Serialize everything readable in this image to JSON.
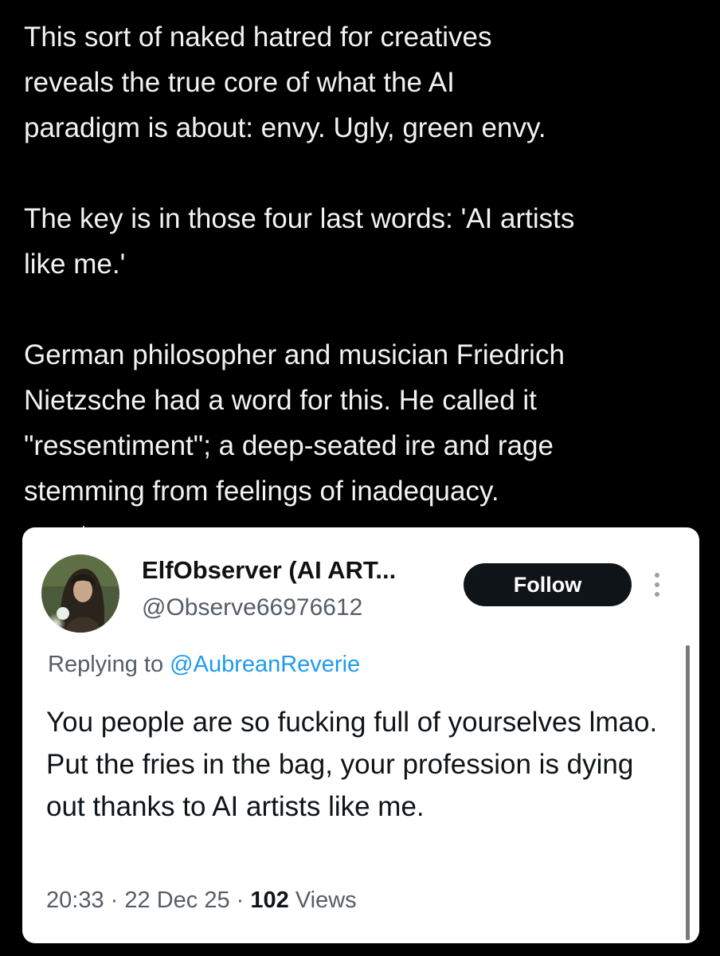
{
  "post": {
    "paragraphs": [
      "This sort of naked hatred for creatives\nreveals the true core of what the AI\nparadigm is about: envy. Ugly, green envy.",
      "The key is in those four last words: 'AI artists\nlike me.'",
      "German philosopher and musician Friedrich\nNietzsche had a word for this. He called it\n\"ressentiment\"; a deep-seated ire and rage\nstemming from feelings of inadequacy."
    ]
  },
  "quoted": {
    "display_name": "ElfObserver (AI ART...",
    "handle": "@Observe66976612",
    "follow_label": "Follow",
    "replying_prefix": "Replying to",
    "replying_to": "@AubreanReverie",
    "text": "You people are so fucking full of yourselves lmao. Put the fries in the bag, your profession is dying out thanks to AI artists like me.",
    "time": "20:33",
    "separator": "·",
    "date": "22 Dec 25",
    "views_count": "102",
    "views_label": "Views"
  },
  "icons": {
    "avatar": "avatar-image",
    "more": "more-vertical-icon"
  },
  "colors": {
    "background": "#000000",
    "card": "#ffffff",
    "link": "#1d9bf0",
    "button": "#0f1419",
    "muted_text": "#555d66"
  }
}
